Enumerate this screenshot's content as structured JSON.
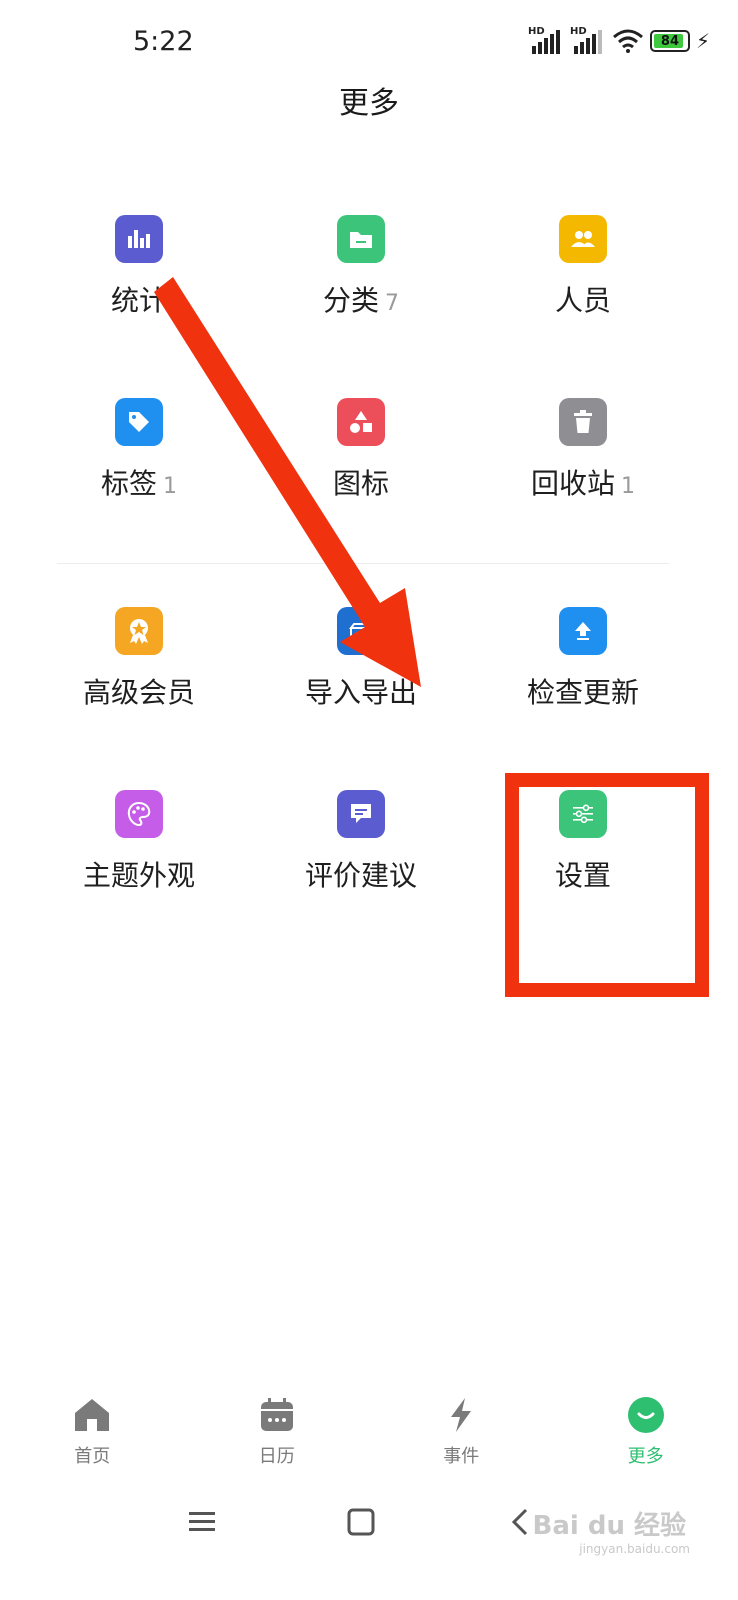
{
  "status": {
    "time": "5:22",
    "sim1_label": "HD",
    "sim2_label": "HD",
    "battery_level": "84"
  },
  "page_title": "更多",
  "grid": {
    "rows": [
      [
        {
          "label": "统计",
          "count": "",
          "icon": "bar-chart-icon",
          "color": "#5b5ccf"
        },
        {
          "label": "分类",
          "count": "7",
          "icon": "folder-icon",
          "color": "#3bc47a"
        },
        {
          "label": "人员",
          "count": "",
          "icon": "people-icon",
          "color": "#f5b800"
        }
      ],
      [
        {
          "label": "标签",
          "count": "1",
          "icon": "tag-icon",
          "color": "#1f8ff0"
        },
        {
          "label": "图标",
          "count": "",
          "icon": "shapes-icon",
          "color": "#ec4f5a"
        },
        {
          "label": "回收站",
          "count": "1",
          "icon": "trash-icon",
          "color": "#8e8e93"
        }
      ],
      [
        {
          "label": "高级会员",
          "count": "",
          "icon": "badge-icon",
          "color": "#f5a623"
        },
        {
          "label": "导入导出",
          "count": "",
          "icon": "import-export-icon",
          "color": "#1f6fd1"
        },
        {
          "label": "检查更新",
          "count": "",
          "icon": "upload-icon",
          "color": "#1f8ff0"
        }
      ],
      [
        {
          "label": "主题外观",
          "count": "",
          "icon": "palette-icon",
          "color": "#c55de8"
        },
        {
          "label": "评价建议",
          "count": "",
          "icon": "comment-icon",
          "color": "#5b5ccf"
        },
        {
          "label": "设置",
          "count": "",
          "icon": "sliders-icon",
          "color": "#3bc47a"
        }
      ]
    ]
  },
  "tabbar": {
    "items": [
      {
        "label": "首页",
        "icon": "home-icon",
        "active": false
      },
      {
        "label": "日历",
        "icon": "calendar-icon",
        "active": false
      },
      {
        "label": "事件",
        "icon": "lightning-icon",
        "active": false
      },
      {
        "label": "更多",
        "icon": "more-smile-icon",
        "active": true
      }
    ]
  },
  "watermark": {
    "text": "Bai du 经验",
    "sub": "jingyan.baidu.com"
  },
  "colors": {
    "accent": "#2fbf71",
    "annotation": "#f0320f",
    "inactive": "#7a7a7a"
  }
}
